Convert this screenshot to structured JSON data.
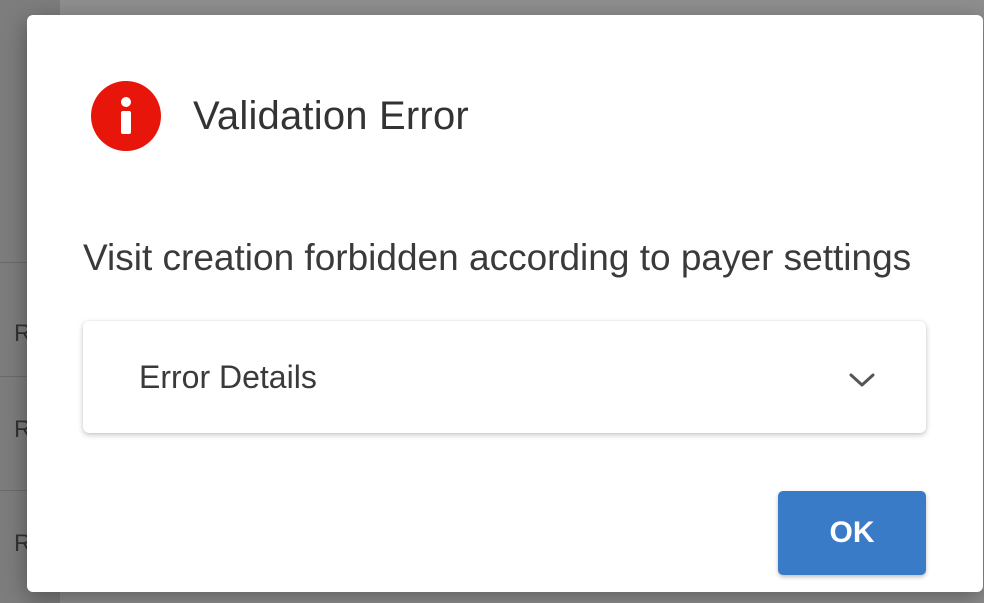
{
  "dialog": {
    "title": "Validation Error",
    "icon": "error-icon",
    "message": "Visit creation forbidden according to payer settings",
    "details_label": "Error Details",
    "ok_label": "OK"
  },
  "background": {
    "row_glyphs": [
      "R",
      "R",
      "R"
    ]
  },
  "colors": {
    "error_red": "#e8150a",
    "primary_button": "#3a7bc8"
  }
}
